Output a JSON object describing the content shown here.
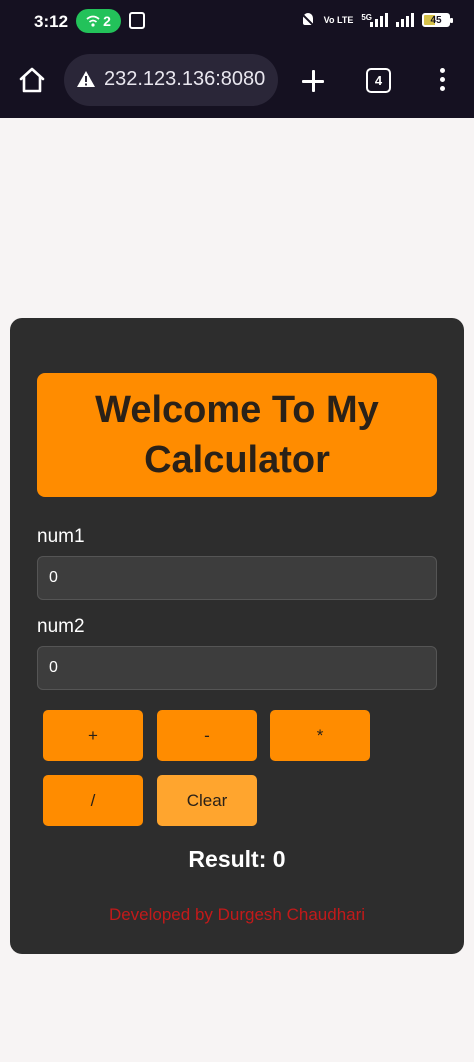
{
  "status_bar": {
    "time": "3:12",
    "hotspot_count": "2",
    "network_label": "5G",
    "volte_label": "Vo LTE",
    "battery_level": "45"
  },
  "browser": {
    "url": "232.123.136:8080",
    "tab_count": "4"
  },
  "calculator": {
    "title": "Welcome To My Calculator",
    "num1_label": "num1",
    "num1_value": "0",
    "num2_label": "num2",
    "num2_value": "0",
    "buttons": {
      "add": "+",
      "subtract": "-",
      "multiply": "*",
      "divide": "/",
      "clear": "Clear"
    },
    "result": "Result: 0",
    "footer": "Developed by Durgesh Chaudhari"
  },
  "colors": {
    "accent": "#ff8c00",
    "card_bg": "#2d2d2d",
    "footer_text": "#c21a1a",
    "browser_bg": "#151121"
  }
}
